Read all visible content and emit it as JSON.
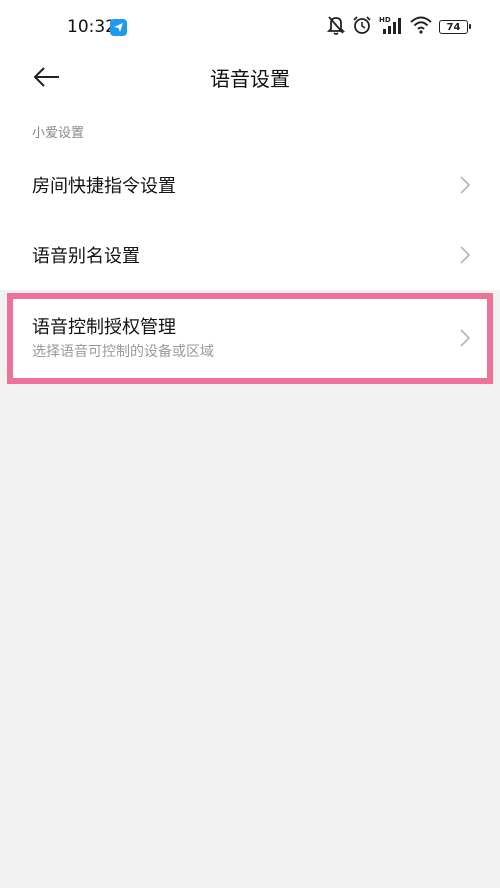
{
  "status_bar": {
    "time": "10:32",
    "battery": "74",
    "icons": [
      "app-icon",
      "mute-bell-icon",
      "alarm-icon",
      "hd-signal-icon",
      "wifi-icon",
      "battery-icon"
    ]
  },
  "header": {
    "title": "语音设置",
    "back_icon": "back-arrow-icon"
  },
  "section": {
    "label": "小爱设置"
  },
  "items": [
    {
      "label": "房间快捷指令设置",
      "chevron": "chevron-right-icon"
    },
    {
      "label": "语音别名设置",
      "chevron": "chevron-right-icon"
    },
    {
      "label": "语音控制授权管理",
      "subtitle": "选择语音可控制的设备或区域",
      "chevron": "chevron-right-icon"
    }
  ],
  "colors": {
    "highlight_border": "#ee7198",
    "background": "#f2f2f2",
    "card": "#ffffff"
  }
}
